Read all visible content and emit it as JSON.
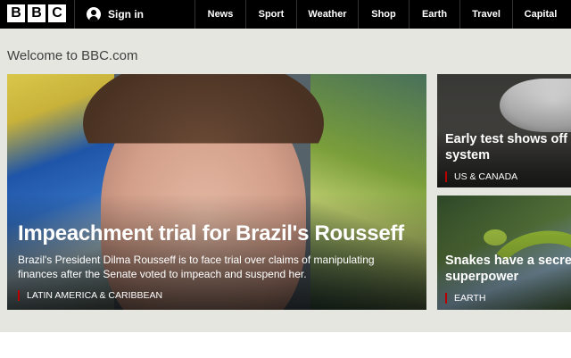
{
  "header": {
    "logo_letters": [
      "B",
      "B",
      "C"
    ],
    "signin_label": "Sign in",
    "nav": [
      "News",
      "Sport",
      "Weather",
      "Shop",
      "Earth",
      "Travel",
      "Capital"
    ]
  },
  "welcome": "Welcome to BBC.com",
  "main_story": {
    "headline": "Impeachment trial for Brazil's Rousseff",
    "summary": "Brazil's President Dilma Rousseff is to face trial over claims of manipulating finances after the Senate voted to impeach and suspend her.",
    "tag": "LATIN AMERICA & CARIBBEAN"
  },
  "side_stories": [
    {
      "headline_line1": "Early test shows off h",
      "headline_line2": "system",
      "tag": "US & CANADA"
    },
    {
      "headline_line1": "Snakes have a secre",
      "headline_line2": "superpower",
      "tag": "EARTH"
    }
  ],
  "colors": {
    "topbar": "#000000",
    "page_bg": "#e6e6e1",
    "tag_accent": "#b80000"
  }
}
